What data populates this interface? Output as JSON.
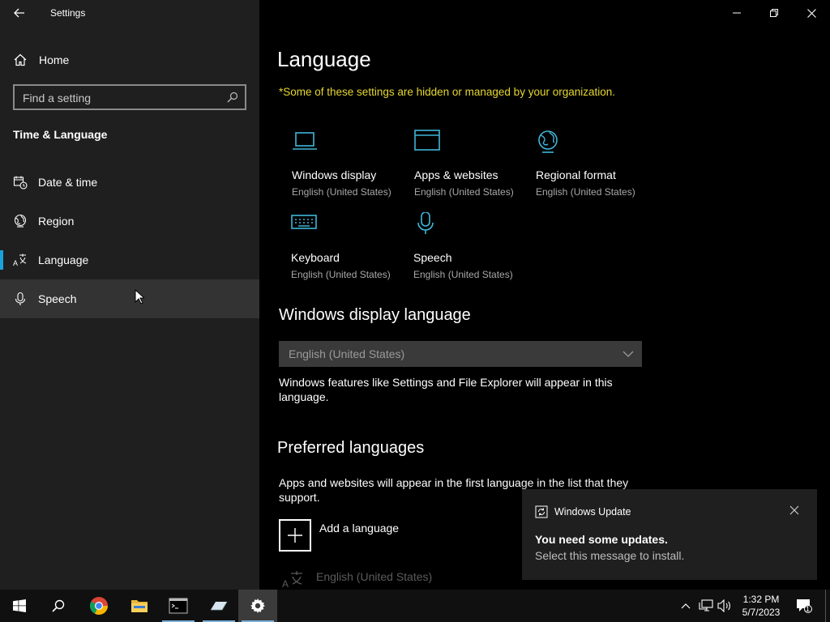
{
  "window": {
    "app_title": "Settings"
  },
  "sidebar": {
    "home_label": "Home",
    "search_placeholder": "Find a setting",
    "section_title": "Time & Language",
    "items": [
      {
        "label": "Date & time",
        "icon": "date-time-icon"
      },
      {
        "label": "Region",
        "icon": "region-globe-icon"
      },
      {
        "label": "Language",
        "icon": "language-icon",
        "selected": true
      },
      {
        "label": "Speech",
        "icon": "microphone-icon",
        "hover": true
      }
    ]
  },
  "main": {
    "title": "Language",
    "managed_note": "*Some of these settings are hidden or managed by your organization.",
    "tiles": [
      {
        "title": "Windows display",
        "subtitle": "English (United States)",
        "icon": "laptop-icon"
      },
      {
        "title": "Apps & websites",
        "subtitle": "English (United States)",
        "icon": "browser-window-icon"
      },
      {
        "title": "Regional format",
        "subtitle": "English (United States)",
        "icon": "globe-format-icon"
      },
      {
        "title": "Keyboard",
        "subtitle": "English (United States)",
        "icon": "keyboard-icon"
      },
      {
        "title": "Speech",
        "subtitle": "English (United States)",
        "icon": "microphone-icon"
      }
    ],
    "display_language": {
      "heading": "Windows display language",
      "selected": "English (United States)",
      "description_line1": "Windows features like Settings and File Explorer will appear in this",
      "description_line2": "language."
    },
    "preferred": {
      "heading": "Preferred languages",
      "description_line1": "Apps and websites will appear in the first language in the list that they",
      "description_line2": "support.",
      "add_label": "Add a language",
      "installed": "English (United States)"
    }
  },
  "toast": {
    "app_name": "Windows Update",
    "headline": "You need some updates.",
    "body": "Select this message to install."
  },
  "taskbar": {
    "time": "1:32 PM",
    "date": "5/7/2023",
    "notification_count": "1"
  },
  "colors": {
    "accent": "#1aa3d8",
    "warning_text": "#e6d630",
    "tile_icon": "#3fb6d8"
  }
}
